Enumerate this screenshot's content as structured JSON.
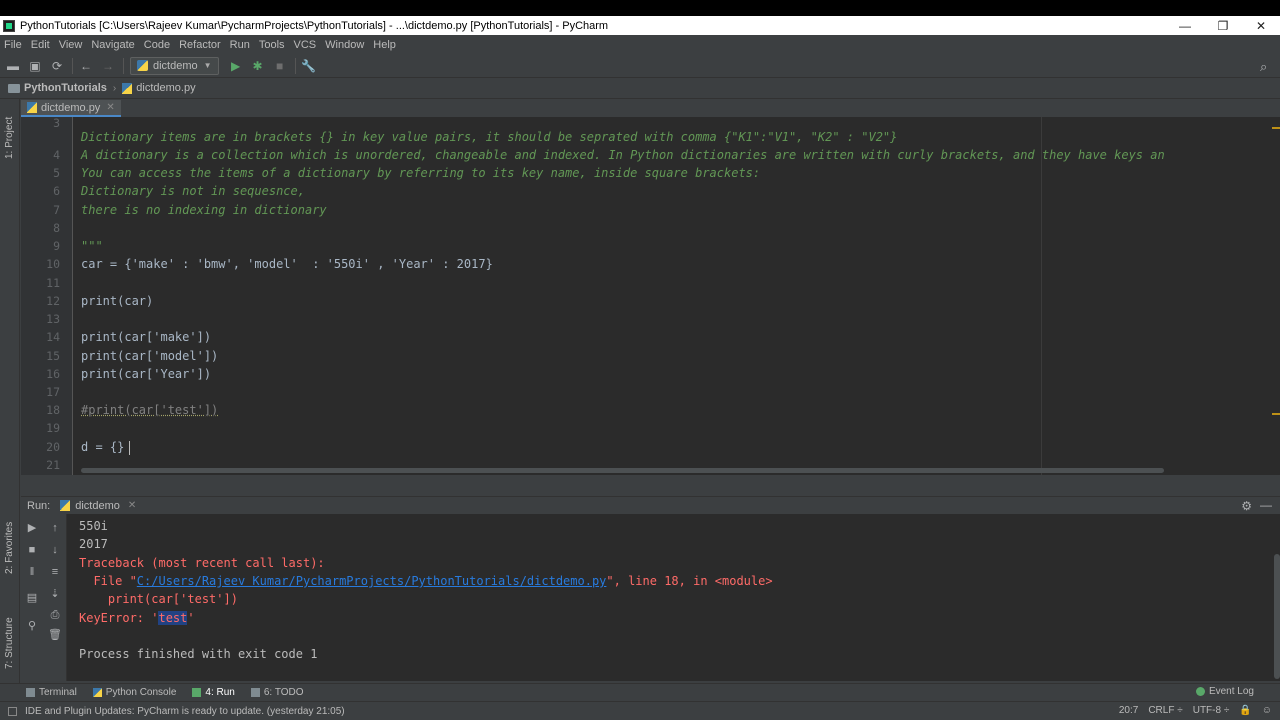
{
  "window": {
    "title": "PythonTutorials [C:\\Users\\Rajeev Kumar\\PycharmProjects\\PythonTutorials] - ...\\dictdemo.py [PythonTutorials] - PyCharm",
    "minimize": "—",
    "maximize": "❐",
    "close": "✕"
  },
  "menu": [
    "File",
    "Edit",
    "View",
    "Navigate",
    "Code",
    "Refactor",
    "Run",
    "Tools",
    "VCS",
    "Window",
    "Help"
  ],
  "toolbar": {
    "run_config": "dictdemo"
  },
  "breadcrumb": {
    "project": "PythonTutorials",
    "file": "dictdemo.py"
  },
  "sidebar": {
    "project_tab": "1: Project",
    "favorites_tab": "2: Favorites",
    "structure_tab": "7: Structure"
  },
  "editor": {
    "tab": "dictdemo.py",
    "lines": [
      {
        "n": "3",
        "text": "Dictionary items are in brackets {} in key value pairs, it should be seprated with comma {\"K1\":\"V1\", \"K2\" : \"V2\"}"
      },
      {
        "n": "4",
        "text": "A dictionary is a collection which is unordered, changeable and indexed. In Python dictionaries are written with curly brackets, and they have keys an"
      },
      {
        "n": "5",
        "text": "You can access the items of a dictionary by referring to its key name, inside square brackets:"
      },
      {
        "n": "6",
        "text": "Dictionary is not in sequesnce,"
      },
      {
        "n": "7",
        "text": "there is no indexing in dictionary"
      },
      {
        "n": "8",
        "text": ""
      },
      {
        "n": "9",
        "text": "\"\"\""
      },
      {
        "n": "10",
        "text": "car = {'make' : 'bmw', 'model'  : '550i' , 'Year' : 2017}"
      },
      {
        "n": "11",
        "text": ""
      },
      {
        "n": "12",
        "text": "print(car)"
      },
      {
        "n": "13",
        "text": ""
      },
      {
        "n": "14",
        "text": "print(car['make'])"
      },
      {
        "n": "15",
        "text": "print(car['model'])"
      },
      {
        "n": "16",
        "text": "print(car['Year'])"
      },
      {
        "n": "17",
        "text": ""
      },
      {
        "n": "18",
        "text": "#print(car['test'])"
      },
      {
        "n": "19",
        "text": ""
      },
      {
        "n": "20",
        "text": "d = {}"
      },
      {
        "n": "21",
        "text": ""
      }
    ]
  },
  "run": {
    "label": "Run:",
    "tab": "dictdemo",
    "output": {
      "l1": "550i",
      "l2": "2017",
      "l3": "Traceback (most recent call last):",
      "l4_pre": "  File \"",
      "l4_link": "C:/Users/Rajeev Kumar/PycharmProjects/PythonTutorials/dictdemo.py",
      "l4_post": "\", line 18, in <module>",
      "l5": "    print(car['test'])",
      "l6_pre": "KeyError: '",
      "l6_sel": "test",
      "l6_post": "'",
      "l7": "Process finished with exit code 1"
    }
  },
  "bottom_tabs": {
    "terminal": "Terminal",
    "python_console": "Python Console",
    "run": "4: Run",
    "todo": "6: TODO",
    "event_log": "Event Log"
  },
  "status": {
    "message": "IDE and Plugin Updates: PyCharm is ready to update. (yesterday 21:05)",
    "position": "20:7",
    "line_sep": "CRLF ÷",
    "encoding": "UTF-8 ÷"
  }
}
